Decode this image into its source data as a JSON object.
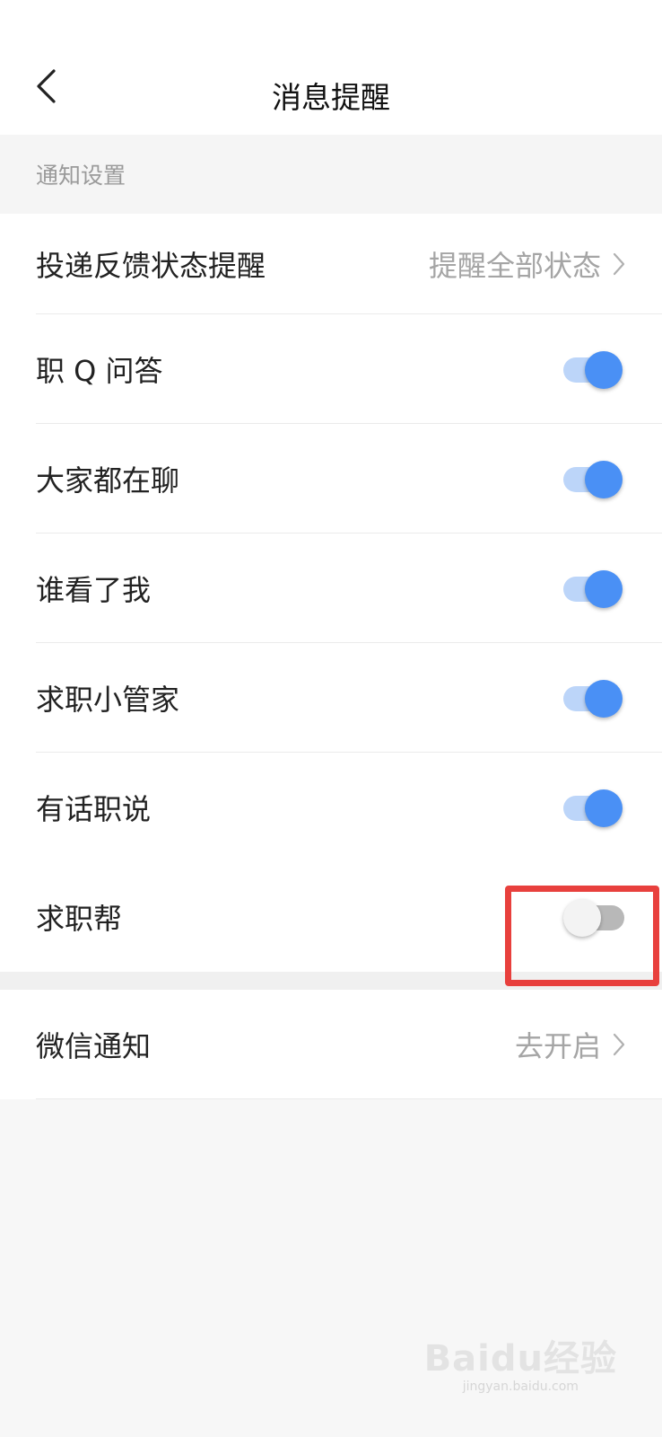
{
  "header": {
    "title": "消息提醒"
  },
  "section": {
    "title": "通知设置"
  },
  "settings": [
    {
      "label": "投递反馈状态提醒",
      "value": "提醒全部状态"
    },
    {
      "label": "职 Q 问答",
      "toggle": "on"
    },
    {
      "label": "大家都在聊",
      "toggle": "on"
    },
    {
      "label": "谁看了我",
      "toggle": "on"
    },
    {
      "label": "求职小管家",
      "toggle": "on"
    },
    {
      "label": "有话职说",
      "toggle": "on"
    },
    {
      "label": "求职帮",
      "toggle": "off"
    }
  ],
  "wechat": {
    "label": "微信通知",
    "value": "去开启"
  },
  "watermark": {
    "brand": "Baidu经验",
    "url": "jingyan.baidu.com"
  },
  "colors": {
    "toggle_on": "#4a90f5",
    "toggle_off": "#b8b8b8",
    "highlight": "#e8403d"
  }
}
